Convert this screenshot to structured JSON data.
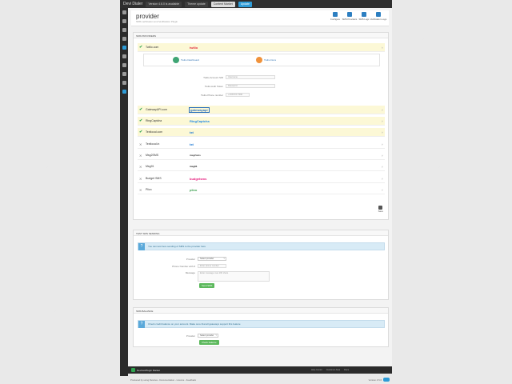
{
  "topbar": {
    "brand": "Devi Dialer",
    "version_notice": "Version 4.6.0 is available",
    "theme_notice": "Theme update",
    "market_label": "Content Market",
    "update_label": "Update"
  },
  "header": {
    "title": "provider",
    "subtitle": "SMS verification and Verification Plugin",
    "buttons": [
      {
        "label": "Configure",
        "icon": "wrench-icon"
      },
      {
        "label": "SMS Providers",
        "icon": "send-icon"
      },
      {
        "label": "SMS Logs",
        "icon": "document-icon"
      },
      {
        "label": "Verification Logs",
        "icon": "document-icon"
      }
    ]
  },
  "gateways": {
    "title": "SMS PROVIDERS",
    "providers": [
      {
        "name": "Twilio.com",
        "logo": "twilio",
        "logo_color": "#e22d3c",
        "enabled": true
      },
      {
        "name": "GatewayAPI.com",
        "logo": "gatewayapi",
        "logo_color": "#2a6fbd",
        "enabled": true
      },
      {
        "name": "RingCaptcha",
        "logo": "RingCaptcha",
        "logo_color": "#1e88e5",
        "enabled": true
      },
      {
        "name": "Textlocal.com",
        "logo": "txt",
        "logo_color": "#1976d2",
        "enabled": true
      },
      {
        "name": "Textlocal.in",
        "logo": "txt",
        "logo_color": "#1976d2",
        "enabled": false
      },
      {
        "name": "Msg2SMS",
        "logo": "msg2sms",
        "logo_color": "#333333",
        "enabled": false
      },
      {
        "name": "Msg91",
        "logo": "msg91",
        "logo_color": "#111111",
        "enabled": false
      },
      {
        "name": "Budget SMS",
        "logo": "budgetsms",
        "logo_color": "#e5197a",
        "enabled": false
      },
      {
        "name": "Plivo",
        "logo": "plivo",
        "logo_color": "#3b9e4e",
        "enabled": false
      }
    ],
    "twilio_panel": {
      "dashboard_label": "Twilio Dashboard",
      "docs_label": "Twilio Docs",
      "fields": [
        {
          "label": "Twilio Account SID",
          "placeholder": "Username"
        },
        {
          "label": "Twilio Auth Token",
          "placeholder": "Password"
        },
        {
          "label": "Twilio Phone number",
          "placeholder": "+1XXXXX 7090"
        }
      ]
    },
    "save_label": "Save"
  },
  "test_section": {
    "title": "TEST SMS SENDING",
    "info": "You can test here sending of SMS to the provider here",
    "provider_label": "Provider",
    "provider_value": "Select provider",
    "phone_label": "Phone Number with #",
    "phone_placeholder": "Enter phone number",
    "message_label": "Message",
    "message_placeholder": "Enter message max 160 chars",
    "send_label": "Send SMS"
  },
  "balance_section": {
    "title": "SMS BALANCE",
    "info": "Check credit balance on your account. Make sure that all gateways support this feature",
    "provider_label": "Provider",
    "provider_value": "Select provider",
    "check_label": "Check balance"
  },
  "footer": {
    "market_label": "DevicesPlugin Market",
    "links": [
      "Help Center",
      "Customer Area",
      "Docs"
    ],
    "copyright": "Produced by using Devices - Documentation - Licence - Feedback",
    "version": "Version 4.5.6"
  },
  "watermark": "ChekodPoint",
  "colors": {
    "accent": "#2d9bd7",
    "success": "#2ea44f",
    "highlight": "#fcf8d6"
  }
}
